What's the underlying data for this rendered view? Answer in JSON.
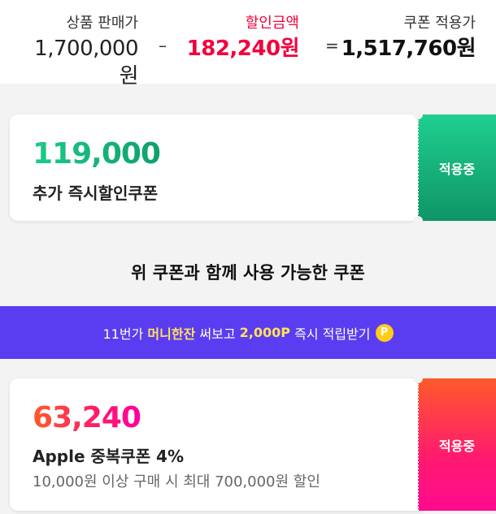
{
  "summary": {
    "price_label": "상품 판매가",
    "price_value": "1,700,000원",
    "minus": "–",
    "discount_label": "할인금액",
    "discount_value": "182,240원",
    "equals": "=",
    "final_label": "쿠폰 적용가",
    "final_value": "1,517,760원"
  },
  "coupon_instant": {
    "amount": "119,000",
    "name": "추가 즉시할인쿠폰",
    "status": "적용중"
  },
  "compatible_title": "위 쿠폰과 함께 사용 가능한 쿠폰",
  "promo_banner": {
    "prefix": "11번가",
    "highlight": "머니한잔",
    "middle": "써보고",
    "points": "2,000P",
    "suffix": "즉시 적립받기",
    "icon": "P"
  },
  "coupon_apple": {
    "amount": "63,240",
    "name": "Apple 중복쿠폰 4%",
    "description": "10,000원 이상 구매 시 최대 700,000원 할인",
    "status": "적용중"
  },
  "colors": {
    "discount_red": "#f2003c",
    "green_coupon": "#1ccb8a",
    "pink_coupon": "#ff1a6a",
    "promo_purple": "#5a3df0",
    "promo_highlight": "#ffe15a"
  }
}
